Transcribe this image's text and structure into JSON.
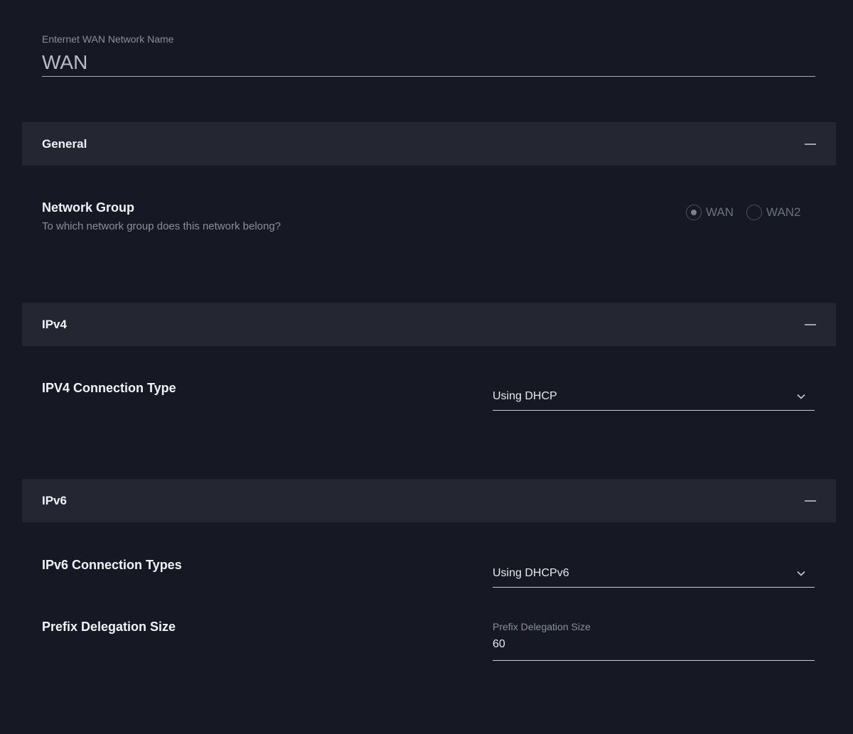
{
  "network_name": {
    "label": "Enternet WAN Network Name",
    "value": "WAN"
  },
  "sections": {
    "general": {
      "title": "General",
      "collapse_icon": "minus-icon"
    },
    "ipv4": {
      "title": "IPv4",
      "collapse_icon": "minus-icon"
    },
    "ipv6": {
      "title": "IPv6",
      "collapse_icon": "minus-icon"
    }
  },
  "network_group": {
    "label": "Network Group",
    "description": "To which network group does this network belong?",
    "options": [
      {
        "label": "WAN",
        "selected": true
      },
      {
        "label": "WAN2",
        "selected": false
      }
    ]
  },
  "ipv4_connection": {
    "label": "IPV4 Connection Type",
    "value": "Using DHCP",
    "icon": "chevron-down-icon"
  },
  "ipv6_connection": {
    "label": "IPv6 Connection Types",
    "value": "Using DHCPv6",
    "icon": "chevron-down-icon"
  },
  "prefix_delegation": {
    "label": "Prefix Delegation Size",
    "field_label": "Prefix Delegation Size",
    "value": "60"
  },
  "colors": {
    "background": "#161923",
    "section_header": "#242731",
    "text_primary": "#f1f3f7",
    "text_secondary": "#8a8f9c"
  }
}
